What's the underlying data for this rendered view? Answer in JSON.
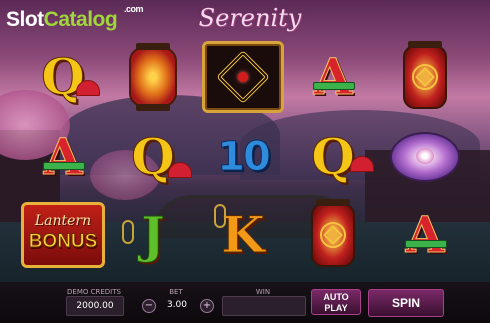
{
  "watermark": {
    "slot": "Slot",
    "catalog": "Catalog",
    "com": ".com"
  },
  "game_title": "Serenity",
  "reels": [
    [
      {
        "symbol": "Q",
        "color": "gold"
      },
      {
        "symbol": "A",
        "color": "red"
      },
      {
        "symbol": "Lantern BONUS",
        "label_top": "Lantern",
        "label_bottom": "BONUS"
      }
    ],
    [
      {
        "symbol": "red-lantern"
      },
      {
        "symbol": "Q",
        "color": "gold"
      },
      {
        "symbol": "J",
        "color": "green"
      }
    ],
    [
      {
        "symbol": "golden-knot"
      },
      {
        "symbol": "10",
        "color": "blue"
      },
      {
        "symbol": "K",
        "color": "orange"
      }
    ],
    [
      {
        "symbol": "A",
        "color": "red"
      },
      {
        "symbol": "Q",
        "color": "gold"
      },
      {
        "symbol": "tall-red-lantern"
      }
    ],
    [
      {
        "symbol": "tall-red-lantern"
      },
      {
        "symbol": "purple-lantern"
      },
      {
        "symbol": "A",
        "color": "red"
      }
    ]
  ],
  "controls": {
    "demo_credits_label": "DEMO CREDITS",
    "demo_credits_value": "2000.00",
    "bet_label": "BET",
    "bet_value": "3.00",
    "bet_minus": "−",
    "bet_plus": "+",
    "win_label": "WIN",
    "win_value": "",
    "autoplay_line1": "AUTO",
    "autoplay_line2": "PLAY",
    "spin_label": "SPIN"
  },
  "colors": {
    "gold_letter": "#f5c518",
    "red_letter": "#d8232a",
    "green_letter": "#5fbf2a",
    "blue_number": "#2f8bdc",
    "orange_letter": "#f29a18",
    "button_accent": "#7a2a68"
  }
}
